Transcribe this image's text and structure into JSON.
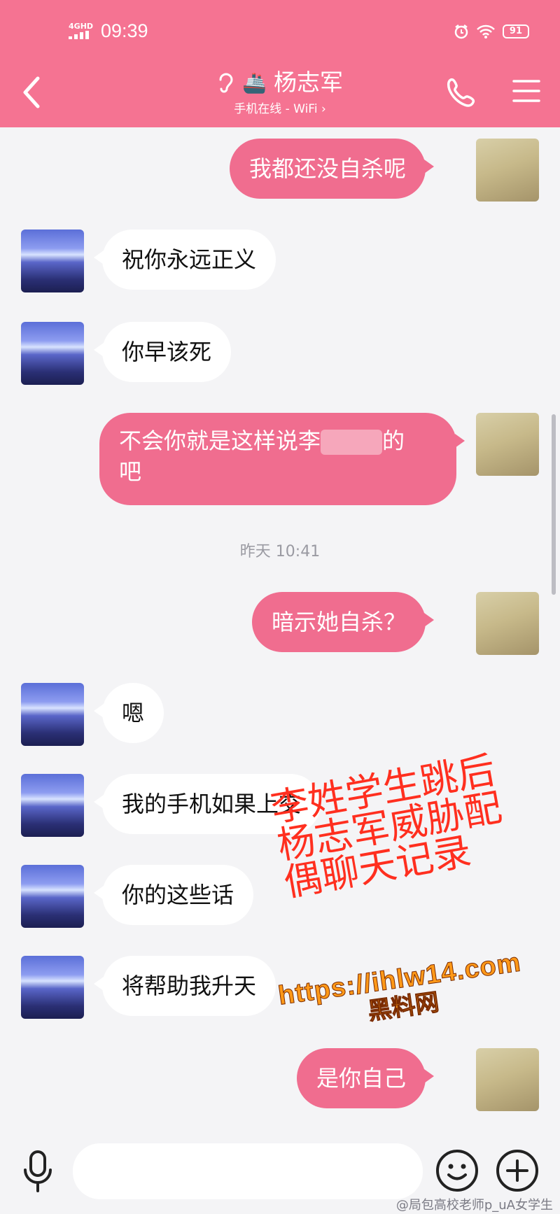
{
  "status": {
    "network": "4G",
    "network_hd": "HD",
    "time": "09:39",
    "battery": "91"
  },
  "header": {
    "back_icon": "chevron-left-icon",
    "ear_icon": "ear-icon",
    "ship_icon": "🚢",
    "contact_name": "杨志军",
    "subtitle": "手机在线 - WiFi",
    "subtitle_arrow": "›"
  },
  "messages": [
    {
      "side": "me",
      "text": "我都还没自杀呢"
    },
    {
      "side": "other",
      "text": "祝你永远正义"
    },
    {
      "side": "other",
      "text": "你早该死"
    },
    {
      "side": "me",
      "text_a": "不会你就是这样说李",
      "text_b": "的",
      "text_c": "吧"
    },
    {
      "side": "me",
      "text": "暗示她自杀？"
    },
    {
      "side": "other",
      "text": "嗯"
    },
    {
      "side": "other",
      "text": "我的手机如果上交"
    },
    {
      "side": "other",
      "text": "你的这些话"
    },
    {
      "side": "other",
      "text": "将帮助我升天"
    },
    {
      "side": "me",
      "text": "是你自己"
    }
  ],
  "timestamp": "昨天 10:41",
  "overlay": {
    "line1": "李姓学生跳后",
    "line2": "杨志军威胁配",
    "line3": "偶聊天记录",
    "color": "#ff2f1f"
  },
  "watermark": {
    "url": "https://ihlw14.com",
    "site": "黑料网"
  },
  "attribution": "@局包高校老师p_uA女学生",
  "colors": {
    "header": "#f57392",
    "my_bubble": "#f06d8f",
    "their_bubble": "#ffffff",
    "background": "#f4f4f6"
  }
}
